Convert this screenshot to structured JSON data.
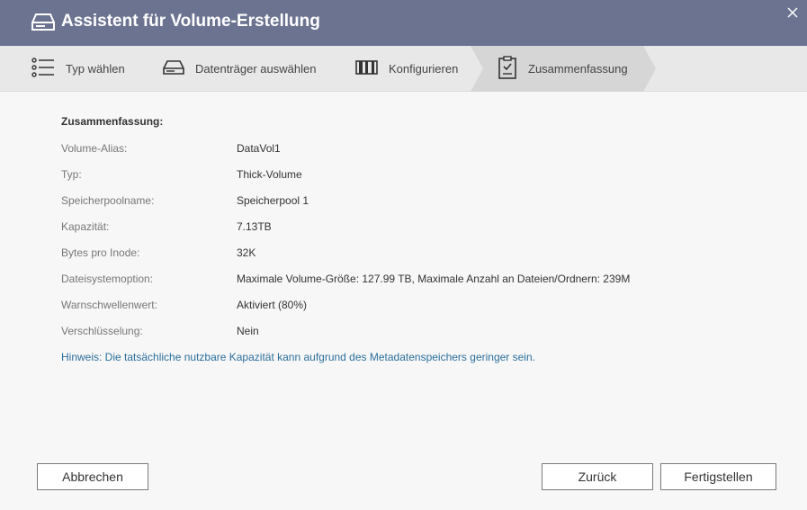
{
  "window": {
    "title": "Assistent für Volume-Erstellung",
    "accent_color": "#6b7391"
  },
  "steps": [
    {
      "label": "Typ wählen",
      "icon": "list-icon",
      "active": false
    },
    {
      "label": "Datenträger auswählen",
      "icon": "drive-icon",
      "active": false
    },
    {
      "label": "Konfigurieren",
      "icon": "configure-icon",
      "active": false
    },
    {
      "label": "Zusammenfassung",
      "icon": "clipboard-check-icon",
      "active": true
    }
  ],
  "summary": {
    "heading": "Zusammenfassung:",
    "rows": [
      {
        "label": "Volume-Alias:",
        "value": "DataVol1"
      },
      {
        "label": "Typ:",
        "value": "Thick-Volume"
      },
      {
        "label": "Speicherpoolname:",
        "value": "Speicherpool 1"
      },
      {
        "label": "Kapazität:",
        "value": "7.13TB"
      },
      {
        "label": "Bytes pro Inode:",
        "value": "32K"
      },
      {
        "label": "Dateisystemoption:",
        "value": "Maximale Volume-Größe: 127.99 TB, Maximale Anzahl an Dateien/Ordnern: 239M"
      },
      {
        "label": "Warnschwellenwert:",
        "value": "Aktiviert (80%)"
      },
      {
        "label": "Verschlüsselung:",
        "value": "Nein"
      }
    ],
    "hint": "Hinweis: Die tatsächliche nutzbare Kapazität kann aufgrund des Metadatenspeichers geringer sein.",
    "hint_color": "#2b6f9c"
  },
  "buttons": {
    "cancel": "Abbrechen",
    "back": "Zurück",
    "finish": "Fertigstellen"
  }
}
